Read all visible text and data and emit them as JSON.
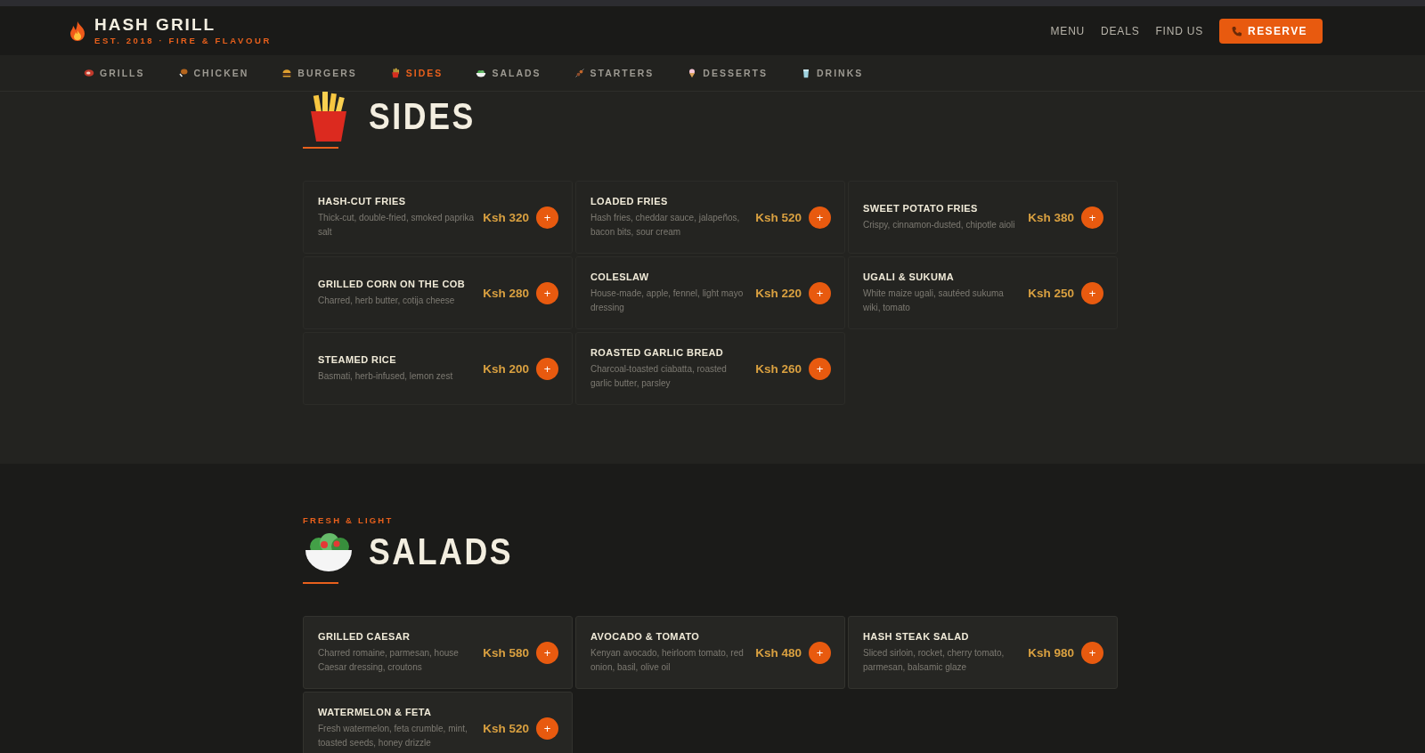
{
  "header": {
    "brand": "HASH GRILL",
    "tagline": "EST. 2018 · FIRE & FLAVOUR",
    "links": [
      "MENU",
      "DEALS",
      "FIND US"
    ],
    "reserve": "RESERVE"
  },
  "categories": [
    {
      "label": "GRILLS",
      "selected": false
    },
    {
      "label": "CHICKEN",
      "selected": false
    },
    {
      "label": "BURGERS",
      "selected": false
    },
    {
      "label": "SIDES",
      "selected": true
    },
    {
      "label": "SALADS",
      "selected": false
    },
    {
      "label": "STARTERS",
      "selected": false
    },
    {
      "label": "DESSERTS",
      "selected": false
    },
    {
      "label": "DRINKS",
      "selected": false
    }
  ],
  "sections": [
    {
      "title": "SIDES",
      "items": [
        {
          "name": "HASH-CUT FRIES",
          "description": "Thick-cut, double-fried, smoked paprika salt",
          "price": "Ksh 320",
          "add": "+"
        },
        {
          "name": "LOADED FRIES",
          "description": "Hash fries, cheddar sauce, jalapeños, bacon bits, sour cream",
          "price": "Ksh 520",
          "add": "+"
        },
        {
          "name": "SWEET POTATO FRIES",
          "description": "Crispy, cinnamon-dusted, chipotle aioli",
          "price": "Ksh 380",
          "add": "+"
        },
        {
          "name": "GRILLED CORN ON THE COB",
          "description": "Charred, herb butter, cotija cheese",
          "price": "Ksh 280",
          "add": "+"
        },
        {
          "name": "COLESLAW",
          "description": "House-made, apple, fennel, light mayo dressing",
          "price": "Ksh 220",
          "add": "+"
        },
        {
          "name": "UGALI & SUKUMA",
          "description": "White maize ugali, sautéed sukuma wiki, tomato",
          "price": "Ksh 250",
          "add": "+"
        },
        {
          "name": "STEAMED RICE",
          "description": "Basmati, herb-infused, lemon zest",
          "price": "Ksh 200",
          "add": "+"
        },
        {
          "name": "ROASTED GARLIC BREAD",
          "description": "Charcoal-toasted ciabatta, roasted garlic butter, parsley",
          "price": "Ksh 260",
          "add": "+"
        }
      ]
    },
    {
      "eyebrow": "FRESH & LIGHT",
      "title": "SALADS",
      "items": [
        {
          "name": "GRILLED CAESAR",
          "description": "Charred romaine, parmesan, house Caesar dressing, croutons",
          "price": "Ksh 580",
          "add": "+"
        },
        {
          "name": "AVOCADO & TOMATO",
          "description": "Kenyan avocado, heirloom tomato, red onion, basil, olive oil",
          "price": "Ksh 480",
          "add": "+"
        },
        {
          "name": "HASH STEAK SALAD",
          "description": "Sliced sirloin, rocket, cherry tomato, parmesan, balsamic glaze",
          "price": "Ksh 980",
          "add": "+"
        },
        {
          "name": "WATERMELON & FETA",
          "description": "Fresh watermelon, feta crumble, mint, toasted seeds, honey drizzle",
          "price": "Ksh 520",
          "add": "+"
        }
      ]
    }
  ]
}
